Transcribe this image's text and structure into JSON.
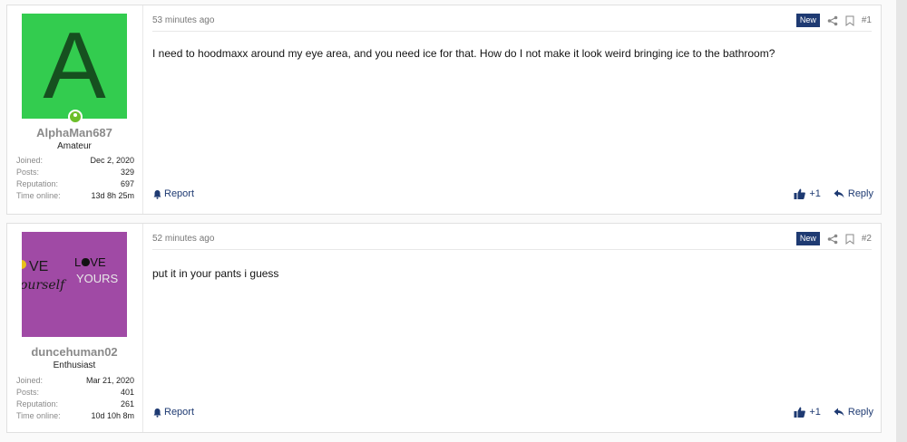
{
  "posts": [
    {
      "avatar_letter": "A",
      "username": "AlphaMan687",
      "rank": "Amateur",
      "stats": [
        {
          "label": "Joined:",
          "value": "Dec 2, 2020"
        },
        {
          "label": "Posts:",
          "value": "329"
        },
        {
          "label": "Reputation:",
          "value": "697"
        },
        {
          "label": "Time online:",
          "value": "13d 8h 25m"
        }
      ],
      "time": "53 minutes ago",
      "badge": "New",
      "number": "#1",
      "text": "I need to hoodmaxx around my eye area, and you need ice for that. How do I not make it look weird bringing ice to the bathroom?",
      "report_label": "Report",
      "plus_label": "+1",
      "reply_label": "Reply"
    },
    {
      "avatar_text": [
        "VE",
        "LOVE",
        "ourself",
        "YOURS"
      ],
      "username": "duncehuman02",
      "rank": "Enthusiast",
      "stats": [
        {
          "label": "Joined:",
          "value": "Mar 21, 2020"
        },
        {
          "label": "Posts:",
          "value": "401"
        },
        {
          "label": "Reputation:",
          "value": "261"
        },
        {
          "label": "Time online:",
          "value": "10d 10h 8m"
        }
      ],
      "time": "52 minutes ago",
      "badge": "New",
      "number": "#2",
      "text": "put it in your pants i guess",
      "report_label": "Report",
      "plus_label": "+1",
      "reply_label": "Reply"
    }
  ],
  "colors": {
    "accent": "#1e3a72",
    "avatar_green": "#33cc4f",
    "avatar_purple": "#a04aa5",
    "online": "#6cbf2a"
  }
}
